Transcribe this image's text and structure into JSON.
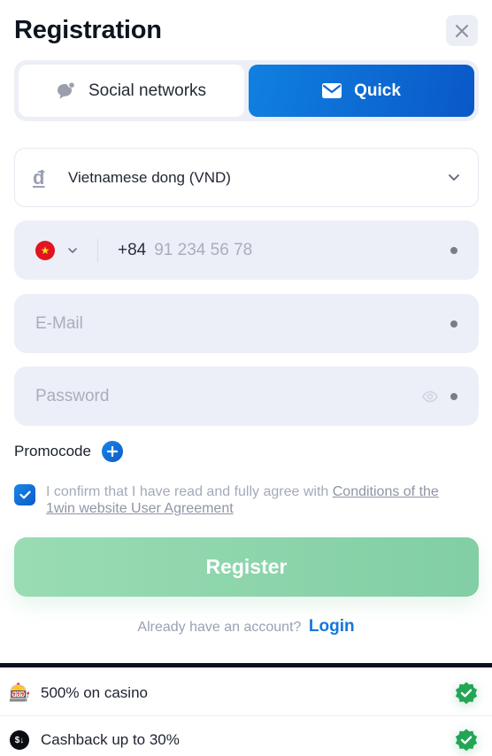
{
  "header": {
    "title": "Registration",
    "close_icon": "close-icon"
  },
  "tabs": [
    {
      "label": "Social networks",
      "icon": "chat-bubble-icon",
      "active": false
    },
    {
      "label": "Quick",
      "icon": "envelope-icon",
      "active": true
    }
  ],
  "currency": {
    "symbol": "đ",
    "label": "Vietnamese dong (VND)",
    "icon": "chevron-down-icon"
  },
  "phone": {
    "country_flag": "vietnam-flag",
    "flag_star": "★",
    "prefix": "+84",
    "placeholder": "91 234 56 78",
    "value": ""
  },
  "email": {
    "placeholder": "E-Mail",
    "value": ""
  },
  "password": {
    "placeholder": "Password",
    "value": ""
  },
  "promocode": {
    "label": "Promocode"
  },
  "agreement": {
    "checked": true,
    "text": "I confirm that I have read and fully agree with ",
    "link_text": "Conditions of the 1win website User Agreement"
  },
  "register": {
    "label": "Register"
  },
  "login": {
    "prompt": "Already have an account?",
    "link": "Login"
  },
  "bonuses": [
    {
      "icon": "slot-machine-icon",
      "glyph": "🎰",
      "label": "500% on casino",
      "verified": true
    },
    {
      "icon": "cashback-icon",
      "glyph": "$↓",
      "label": "Cashback up to 30%",
      "verified": true
    }
  ],
  "colors": {
    "accent_blue": "#0a6ad6",
    "register_green": "#8cd5ac",
    "field_bg": "#eceff7",
    "badge_green": "#22a455"
  }
}
